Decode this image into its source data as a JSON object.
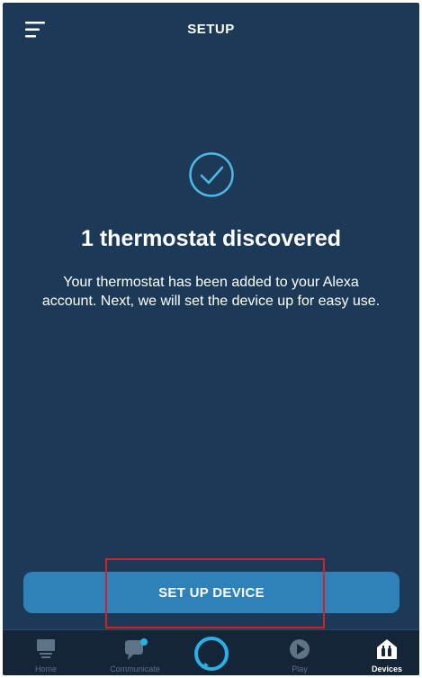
{
  "header": {
    "title": "SETUP",
    "menu_icon": "hamburger-menu-icon"
  },
  "main": {
    "status_icon": "checkmark-circle-icon",
    "heading": "1 thermostat discovered",
    "body": "Your thermostat has been added to your Alexa account. Next, we will set the device up for easy use."
  },
  "action": {
    "button_label": "SET UP DEVICE"
  },
  "nav": {
    "items": [
      {
        "label": "Home",
        "icon": "home-icon",
        "active": false
      },
      {
        "label": "Communicate",
        "icon": "chat-bubble-icon",
        "active": false
      },
      {
        "label": "",
        "icon": "alexa-ring-icon",
        "active": false
      },
      {
        "label": "Play",
        "icon": "play-icon",
        "active": false
      },
      {
        "label": "Devices",
        "icon": "devices-house-icon",
        "active": true
      }
    ]
  },
  "colors": {
    "background": "#1c3a57",
    "accent": "#2f82b8",
    "check": "#4fb8e4",
    "highlight": "#d42128",
    "nav_background": "#132536"
  }
}
